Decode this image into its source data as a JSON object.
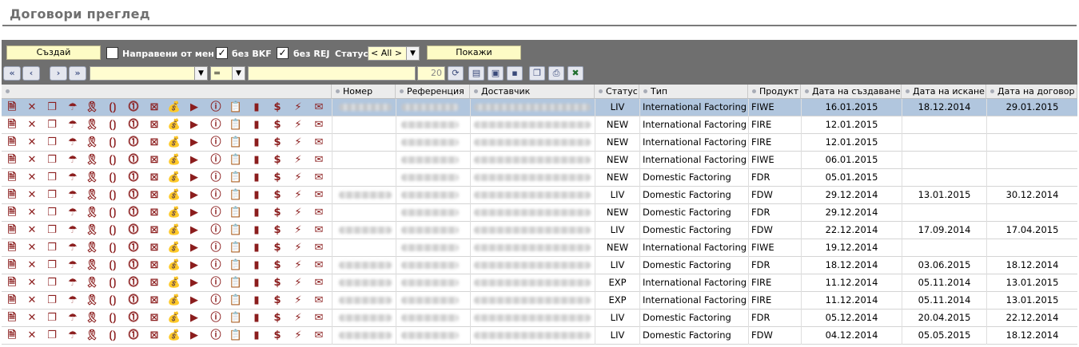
{
  "page": {
    "title": "Договори преглед"
  },
  "toolbar": {
    "create_label": "Създай",
    "made_by_me_label": "Направени от мен",
    "made_by_me_checked": false,
    "no_bkf_label": "без BKF",
    "no_bkf_checked": true,
    "no_rej_label": "без REJ",
    "no_rej_checked": true,
    "status_label": "Статус",
    "status_value": "< All >",
    "show_label": "Покажи",
    "operator_value": "=",
    "page_size": "20",
    "checked_glyph": "✓"
  },
  "columns": [
    "Номер",
    "Референция",
    "Доставчик",
    "Статус",
    "Тип",
    "Продукт",
    "Дата на създаване",
    "Дата на искане",
    "Дата на договор"
  ],
  "row_icons": [
    "document-icon",
    "delete-icon",
    "windows-icon",
    "umbrella-icon",
    "ribbon-icon",
    "brackets-icon",
    "calendar-one-icon",
    "crossed-box-icon",
    "money-bag-icon",
    "play-arrow-icon",
    "info-icon",
    "clipboard-icon",
    "stack-icon",
    "dollar-icon",
    "lightning-icon",
    "mail-icon"
  ],
  "icon_glyphs": [
    "🗎",
    "✕",
    "❐",
    "☂",
    "🎗",
    "⟮⟯",
    "⓵",
    "⊠",
    "💰",
    "▶",
    "ⓘ",
    "📋",
    "▮",
    "$",
    "⚡",
    "✉"
  ],
  "rows": [
    {
      "status": "LIV",
      "type": "International Factoring",
      "product": "FIWE",
      "created": "16.01.2015",
      "requested": "18.12.2014",
      "contract": "29.01.2015",
      "has_number": true,
      "selected": true
    },
    {
      "status": "NEW",
      "type": "International Factoring",
      "product": "FIRE",
      "created": "12.01.2015",
      "requested": "",
      "contract": "",
      "has_number": false,
      "selected": false
    },
    {
      "status": "NEW",
      "type": "International Factoring",
      "product": "FIRE",
      "created": "12.01.2015",
      "requested": "",
      "contract": "",
      "has_number": false,
      "selected": false
    },
    {
      "status": "NEW",
      "type": "International Factoring",
      "product": "FIWE",
      "created": "06.01.2015",
      "requested": "",
      "contract": "",
      "has_number": false,
      "selected": false
    },
    {
      "status": "NEW",
      "type": "Domestic Factoring",
      "product": "FDR",
      "created": "05.01.2015",
      "requested": "",
      "contract": "",
      "has_number": false,
      "selected": false
    },
    {
      "status": "LIV",
      "type": "Domestic Factoring",
      "product": "FDW",
      "created": "29.12.2014",
      "requested": "13.01.2015",
      "contract": "30.12.2014",
      "has_number": true,
      "selected": false
    },
    {
      "status": "NEW",
      "type": "Domestic Factoring",
      "product": "FDR",
      "created": "29.12.2014",
      "requested": "",
      "contract": "",
      "has_number": false,
      "selected": false
    },
    {
      "status": "LIV",
      "type": "Domestic Factoring",
      "product": "FDW",
      "created": "22.12.2014",
      "requested": "17.09.2014",
      "contract": "17.04.2015",
      "has_number": true,
      "selected": false
    },
    {
      "status": "NEW",
      "type": "International Factoring",
      "product": "FIWE",
      "created": "19.12.2014",
      "requested": "",
      "contract": "",
      "has_number": false,
      "selected": false
    },
    {
      "status": "LIV",
      "type": "Domestic Factoring",
      "product": "FDR",
      "created": "18.12.2014",
      "requested": "03.06.2015",
      "contract": "18.12.2014",
      "has_number": true,
      "selected": false
    },
    {
      "status": "EXP",
      "type": "International Factoring",
      "product": "FIRE",
      "created": "11.12.2014",
      "requested": "05.11.2014",
      "contract": "13.01.2015",
      "has_number": true,
      "selected": false
    },
    {
      "status": "EXP",
      "type": "International Factoring",
      "product": "FIRE",
      "created": "11.12.2014",
      "requested": "05.11.2014",
      "contract": "13.01.2015",
      "has_number": true,
      "selected": false
    },
    {
      "status": "LIV",
      "type": "Domestic Factoring",
      "product": "FDR",
      "created": "05.12.2014",
      "requested": "20.04.2015",
      "contract": "22.12.2014",
      "has_number": true,
      "selected": false
    },
    {
      "status": "LIV",
      "type": "Domestic Factoring",
      "product": "FDW",
      "created": "04.12.2014",
      "requested": "05.05.2015",
      "contract": "18.12.2014",
      "has_number": true,
      "selected": false
    }
  ]
}
